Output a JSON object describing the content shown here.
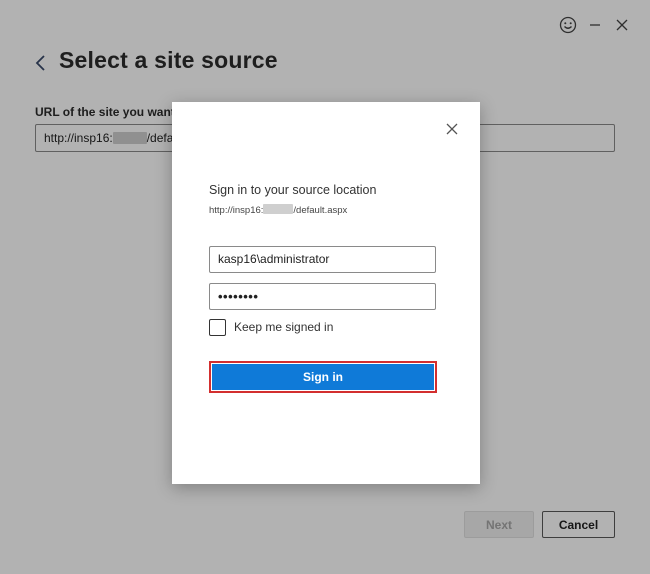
{
  "window": {
    "feedback_icon": "smiley-icon",
    "minimize_icon": "minimize-icon",
    "close_icon": "close-icon"
  },
  "page": {
    "back_icon": "chevron-left-icon",
    "title": "Select a site source",
    "url_label": "URL of the site you want",
    "url_value_prefix": "http://insp16:",
    "url_value_suffix": "/defa"
  },
  "footer": {
    "next_label": "Next",
    "cancel_label": "Cancel"
  },
  "dialog": {
    "close_icon": "close-icon",
    "heading": "Sign in to your source location",
    "url_prefix": "http://insp16:",
    "url_suffix": "/default.aspx",
    "username_value": "kasp16\\administrator",
    "password_value": "••••••••",
    "keep_signed_in_label": "Keep me signed in",
    "keep_signed_in_checked": false,
    "signin_label": "Sign in"
  },
  "colors": {
    "accent": "#0f7ad8",
    "highlight_border": "#d32f2f",
    "overlay": "rgba(0,0,0,0.30)"
  }
}
